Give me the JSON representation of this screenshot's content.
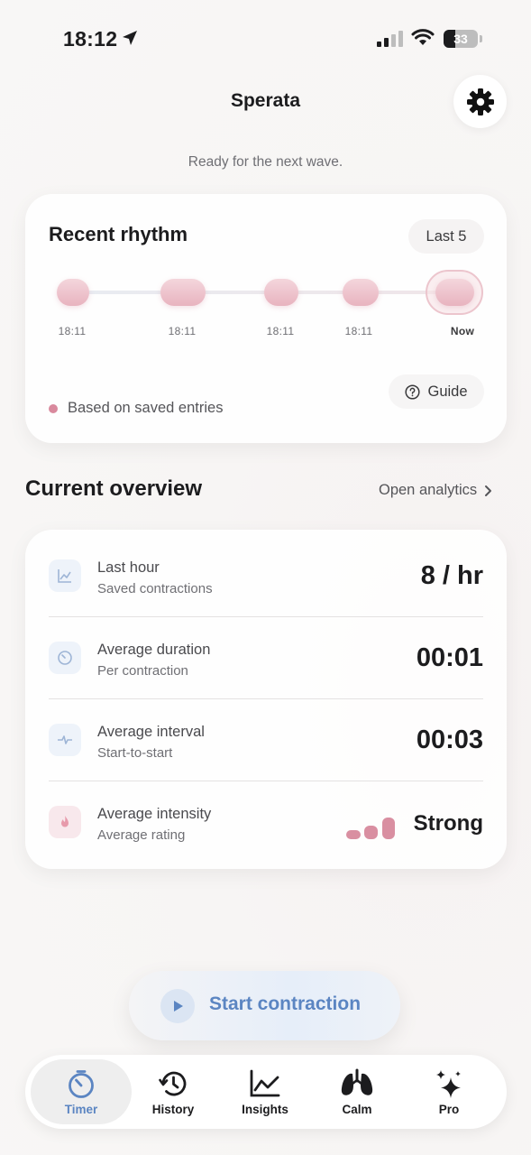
{
  "status_bar": {
    "time": "18:12",
    "battery": "33",
    "battery_level": 0.33
  },
  "header": {
    "title": "Sperata",
    "subtitle": "Ready for the next wave."
  },
  "rhythm": {
    "title": "Recent rhythm",
    "range_label": "Last 5",
    "ticks": [
      "18:11",
      "18:11",
      "18:11",
      "18:11",
      "Now"
    ],
    "guide_label": "Guide",
    "legend": "Based on saved entries"
  },
  "overview": {
    "title": "Current overview",
    "link_label": "Open analytics",
    "rows": [
      {
        "label": "Last hour",
        "sub": "Saved contractions",
        "value": "8 / hr"
      },
      {
        "label": "Average duration",
        "sub": "Per contraction",
        "value": "00:01"
      },
      {
        "label": "Average interval",
        "sub": "Start-to-start",
        "value": "00:03"
      },
      {
        "label": "Average intensity",
        "sub": "Average rating",
        "value": "Strong",
        "level": 3,
        "max_level": 3
      }
    ]
  },
  "start_button": {
    "label": "Start contraction"
  },
  "tabs": [
    {
      "label": "Timer",
      "icon": "timer-icon",
      "active": true
    },
    {
      "label": "History",
      "icon": "history-icon"
    },
    {
      "label": "Insights",
      "icon": "insights-icon"
    },
    {
      "label": "Calm",
      "icon": "lungs-icon"
    },
    {
      "label": "Pro",
      "icon": "sparkles-icon"
    }
  ],
  "colors": {
    "accent": "#5b85c2",
    "rose": "#d98fa1"
  }
}
